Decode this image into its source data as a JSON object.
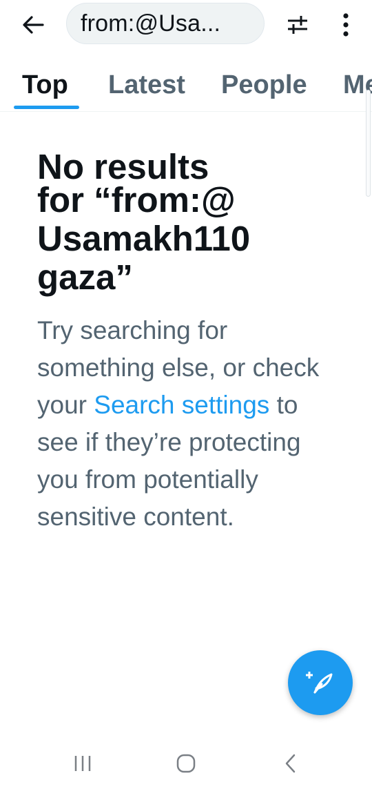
{
  "search": {
    "query": "from:@Usa..."
  },
  "tabs": [
    {
      "label": "Top",
      "active": true
    },
    {
      "label": "Latest",
      "active": false
    },
    {
      "label": "People",
      "active": false
    },
    {
      "label": "Me",
      "active": false
    }
  ],
  "empty_state": {
    "heading_line1": "No results",
    "heading_line2": "for “from:@",
    "heading_line3": "Usamakh110",
    "heading_line4": "gaza”",
    "body_before_link": "Try searching for something else, or check your ",
    "link_text": "Search settings",
    "body_after_link": " to see if they’re protecting you from potentially sensitive content."
  },
  "icons": {
    "back": "arrow-left-icon",
    "filter": "sliders-icon",
    "more": "more-vertical-icon",
    "compose": "compose-post-icon",
    "nav_recent": "recent-apps-icon",
    "nav_home": "home-icon",
    "nav_back": "back-chevron-icon"
  },
  "colors": {
    "accent": "#1d9bf0",
    "text_primary": "#0f1419",
    "text_secondary": "#536471",
    "pill_bg": "#eff3f4"
  }
}
